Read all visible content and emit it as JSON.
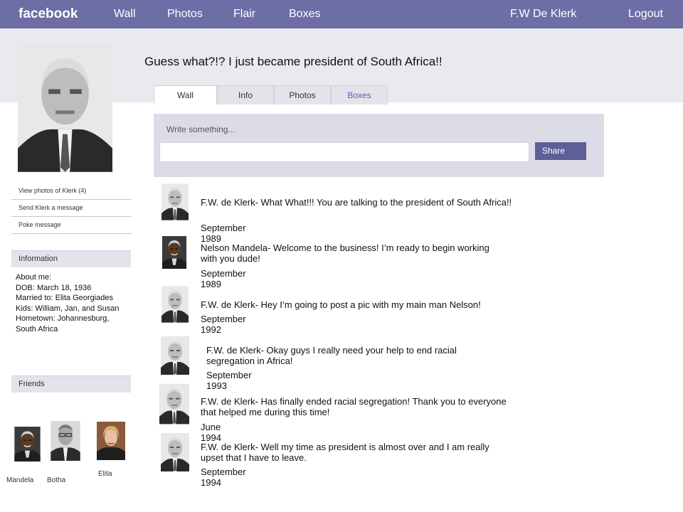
{
  "nav": {
    "brand": "facebook",
    "links": [
      "Wall",
      "Photos",
      "Flair",
      "Boxes"
    ],
    "user": "F.W De Klerk",
    "logout": "Logout"
  },
  "profile": {
    "status": "Guess what?!? I just became president of South Africa!!"
  },
  "tabs": [
    "Wall",
    "Info",
    "Photos",
    "Boxes"
  ],
  "composer": {
    "prompt": "Write something...",
    "value": "",
    "share_label": "Share"
  },
  "sidebar": {
    "links": [
      "View photos of Klerk (4)",
      "Send Klerk a message",
      "Poke message"
    ],
    "information_header": "Information",
    "about": [
      "About me:",
      "DOB: March 18, 1936",
      "Married to: Elita Georgiades",
      "Kids: William, Jan, and Susan",
      "Hometown: Johannesburg, South Africa"
    ],
    "friends_header": "Friends",
    "friends": [
      "Mandela",
      "Botha",
      "Elita"
    ]
  },
  "wall": [
    {
      "author": "F.W. de Klerk",
      "text": "F.W. de Klerk- What What!!! You are talking to the president of South Africa!!",
      "date": "September 1989"
    },
    {
      "author": "Nelson Mandela",
      "text": "Nelson Mandela- Welcome to the business! I’m ready to begin working with you dude!",
      "date": "September 1989"
    },
    {
      "author": "F.W. de Klerk",
      "text": "F.W. de Klerk- Hey I’m going to  post a pic with my main man Nelson!",
      "date": "September 1992"
    },
    {
      "author": "F.W. de Klerk",
      "text": "F.W. de Klerk- Okay guys I really need your help to end racial segregation in Africa!",
      "date": "September 1993"
    },
    {
      "author": "F.W. de Klerk",
      "text": "F.W. de Klerk- Has finally ended racial segregation! Thank you to everyone that helped me during this time!",
      "date": "June 1994"
    },
    {
      "author": "F.W. de Klerk",
      "text": "F.W. de Klerk- Well my time as president is almost over and I am really upset that I have to leave.",
      "date": "September 1994"
    }
  ]
}
